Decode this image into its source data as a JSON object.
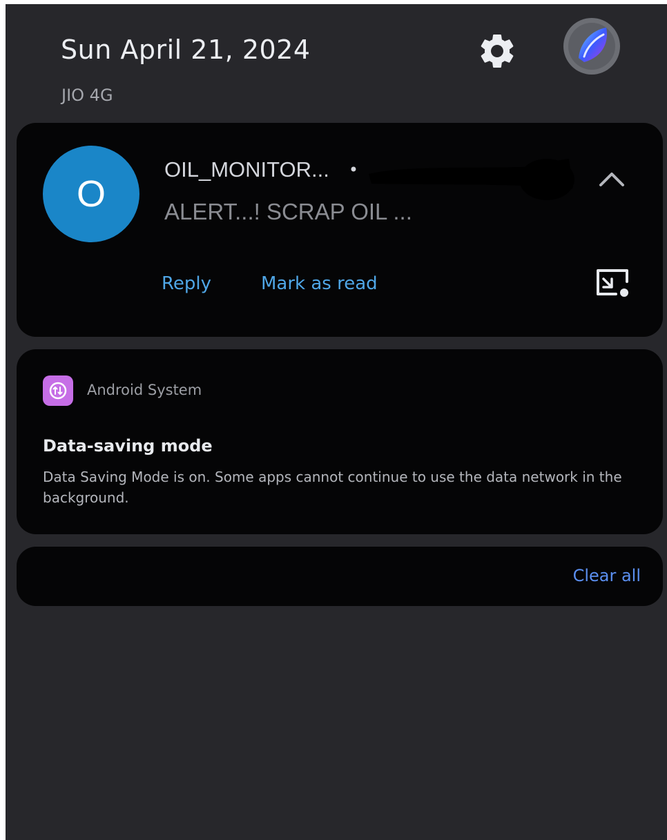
{
  "header": {
    "date": "Sun April 21, 2024",
    "carrier": "JIO 4G",
    "settings_icon": "gear-icon",
    "profile_icon": "avatar"
  },
  "message_notification": {
    "avatar_letter": "O",
    "avatar_color": "#1a86c8",
    "sender": "OIL_MONITOR...",
    "separator": "•",
    "message": "ALERT...! SCRAP OIL ...",
    "actions": {
      "reply": "Reply",
      "mark_read": "Mark as read"
    },
    "accent_color": "#4fa6e6"
  },
  "system_notification": {
    "app_name": "Android System",
    "app_icon_color": "#c66ee6",
    "title": "Data-saving mode",
    "body": "Data Saving Mode is on. Some apps cannot continue to use the data network in the background."
  },
  "footer": {
    "clear_all": "Clear all",
    "clear_all_color": "#5b8ff0"
  },
  "colors": {
    "panel_bg": "#27272b",
    "card_bg": "#050506"
  }
}
